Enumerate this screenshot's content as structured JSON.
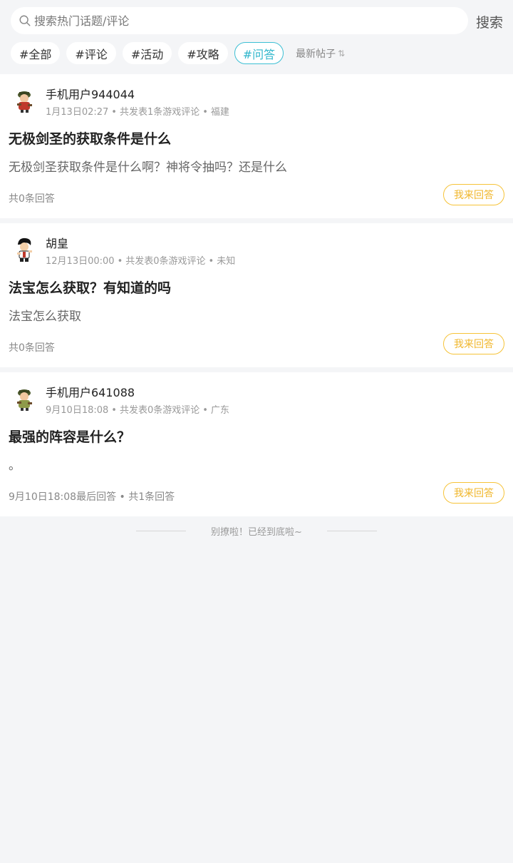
{
  "search": {
    "placeholder": "搜索热门话题/评论",
    "button_label": "搜索"
  },
  "tags": [
    {
      "label": "#全部",
      "active": false
    },
    {
      "label": "#评论",
      "active": false
    },
    {
      "label": "#活动",
      "active": false
    },
    {
      "label": "#攻略",
      "active": false
    },
    {
      "label": "#问答",
      "active": true
    }
  ],
  "sort": {
    "label": "最新帖子",
    "icon": "sort-arrows-icon"
  },
  "posts": [
    {
      "username": "手机用户944044",
      "time": "1月13日02:27",
      "count_text": "共发表1条游戏评论",
      "region": "福建",
      "title": "无极剑圣的获取条件是什么",
      "body": "无极剑圣获取条件是什么啊？神将令抽吗？还是什么",
      "footer": "共0条回答",
      "button": "我来回答"
    },
    {
      "username": "胡皇",
      "time": "12月13日00:00",
      "count_text": "共发表0条游戏评论",
      "region": "未知",
      "title": "法宝怎么获取？有知道的吗",
      "body": "法宝怎么获取",
      "footer": "共0条回答",
      "button": "我来回答"
    },
    {
      "username": "手机用户641088",
      "time": "9月10日18:08",
      "count_text": "共发表0条游戏评论",
      "region": "广东",
      "title": "最强的阵容是什么？",
      "body": "。",
      "footer": "9月10日18:08最后回答 • 共1条回答",
      "button": "我来回答"
    }
  ],
  "end_text": "别撩啦！已经到底啦~",
  "colors": {
    "accent": "#3cbfd4",
    "answer": "#f6c338",
    "background": "#f4f5f7"
  }
}
